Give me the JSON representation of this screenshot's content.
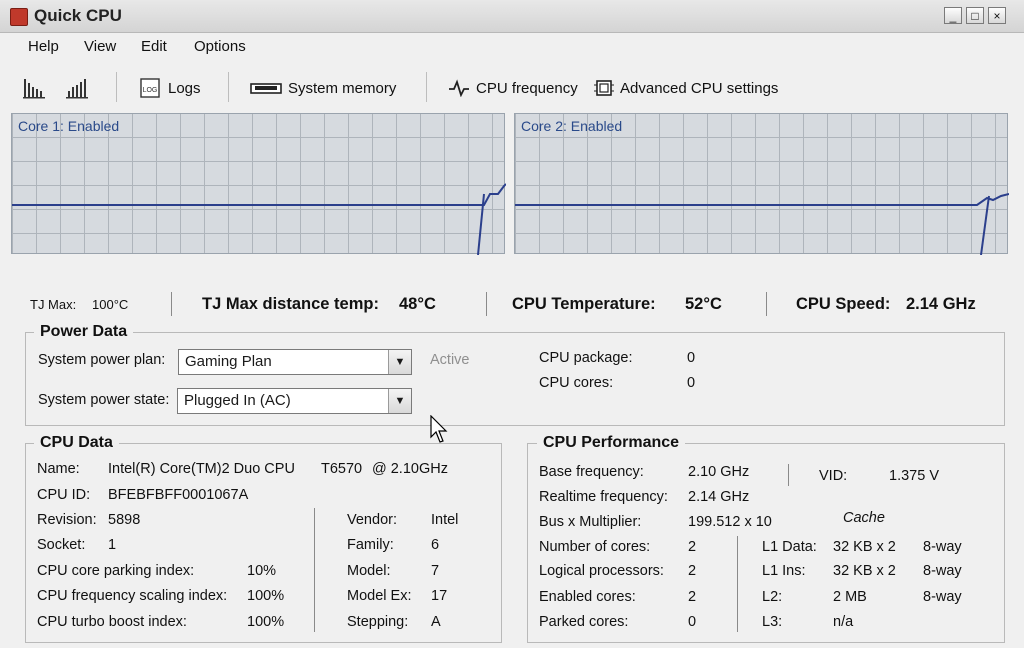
{
  "window": {
    "title": "Quick CPU",
    "buttons": {
      "minimize": "_",
      "maximize": "□",
      "close": "×"
    }
  },
  "menu": [
    "Help",
    "View",
    "Edit",
    "Options"
  ],
  "toolbar": {
    "logs": "Logs",
    "system_memory": "System memory",
    "cpu_frequency": "CPU frequency",
    "advanced": "Advanced CPU settings",
    "logs_icon_text": "LOG"
  },
  "graphs": {
    "core1": "Core 1: Enabled",
    "core2": "Core 2: Enabled"
  },
  "stats": {
    "tj_max_label": "TJ Max:",
    "tj_max_value": "100°C",
    "tj_dist_label": "TJ Max distance temp:",
    "tj_dist_value": "48°C",
    "cpu_temp_label": "CPU Temperature:",
    "cpu_temp_value": "52°C",
    "cpu_speed_label": "CPU Speed:",
    "cpu_speed_value": "2.14 GHz"
  },
  "power": {
    "title": "Power Data",
    "plan_label": "System power plan:",
    "plan_value": "Gaming Plan",
    "active": "Active",
    "state_label": "System power state:",
    "state_value": "Plugged In (AC)",
    "package_label": "CPU package:",
    "package_value": "0",
    "cores_label": "CPU cores:",
    "cores_value": "0"
  },
  "cpu_data": {
    "title": "CPU Data",
    "name_label": "Name:",
    "name_value": "Intel(R) Core(TM)2 Duo CPU",
    "name_model": "T6570",
    "name_speed": "@ 2.10GHz",
    "id_label": "CPU ID:",
    "id_value": "BFEBFBFF0001067A",
    "revision_label": "Revision:",
    "revision_value": "5898",
    "socket_label": "Socket:",
    "socket_value": "1",
    "parking_label": "CPU core parking index:",
    "parking_value": "10%",
    "scaling_label": "CPU frequency scaling index:",
    "scaling_value": "100%",
    "turbo_label": "CPU turbo boost index:",
    "turbo_value": "100%",
    "vendor_label": "Vendor:",
    "vendor_value": "Intel",
    "family_label": "Family:",
    "family_value": "6",
    "model_label": "Model:",
    "model_value": "7",
    "modelex_label": "Model Ex:",
    "modelex_value": "17",
    "stepping_label": "Stepping:",
    "stepping_value": "A"
  },
  "cpu_perf": {
    "title": "CPU Performance",
    "base_label": "Base frequency:",
    "base_value": "2.10 GHz",
    "vid_label": "VID:",
    "vid_value": "1.375 V",
    "realtime_label": "Realtime frequency:",
    "realtime_value": "2.14 GHz",
    "bus_label": "Bus x Multiplier:",
    "bus_value": "199.512 x 10",
    "cache_title": "Cache",
    "numcores_label": "Number of cores:",
    "numcores_value": "2",
    "logical_label": "Logical processors:",
    "logical_value": "2",
    "enabled_label": "Enabled cores:",
    "enabled_value": "2",
    "parked_label": "Parked cores:",
    "parked_value": "0",
    "l1d_label": "L1 Data:",
    "l1d_size": "32 KB x 2",
    "l1d_way": "8-way",
    "l1i_label": "L1 Ins:",
    "l1i_size": "32 KB x 2",
    "l1i_way": "8-way",
    "l2_label": "L2:",
    "l2_size": "2 MB",
    "l2_way": "8-way",
    "l3_label": "L3:",
    "l3_size": "n/a"
  },
  "colors": {
    "graph_line": "#2b3f8c",
    "graph_bg": "#d6dadf",
    "grid": "#aeb4bb"
  }
}
